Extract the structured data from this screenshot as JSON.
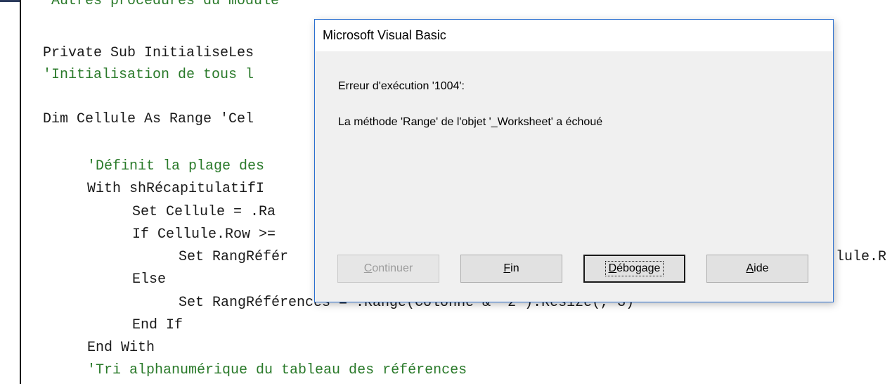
{
  "editor": {
    "lines": [
      "'Autres procédures du module",
      "Private Sub InitialiseLes",
      "'Initialisation de tous l",
      "Dim Cellule As Range 'Cel",
      "'Définit la plage des",
      "With shRécapitulatifI",
      "Set Cellule = .Ra",
      "If Cellule.Row >=",
      "Set RangRéfér",
      "lule.R",
      "Else",
      "Set RangRéférences = .Range(Colonne & \"2\").Resize(, 3)",
      "End If",
      "End With",
      "'Tri alphanumérique du tableau des références"
    ]
  },
  "dialog": {
    "title": "Microsoft Visual Basic",
    "error_line": "Erreur d'exécution '1004':",
    "error_message": "La méthode 'Range' de l'objet '_Worksheet' a échoué",
    "buttons": {
      "continue": {
        "first": "C",
        "rest": "ontinuer",
        "enabled": false
      },
      "end": {
        "first": "F",
        "rest": "in"
      },
      "debug": {
        "first": "D",
        "rest": "ébogage",
        "focused": true
      },
      "help": {
        "first": "A",
        "rest": "ide"
      }
    }
  }
}
